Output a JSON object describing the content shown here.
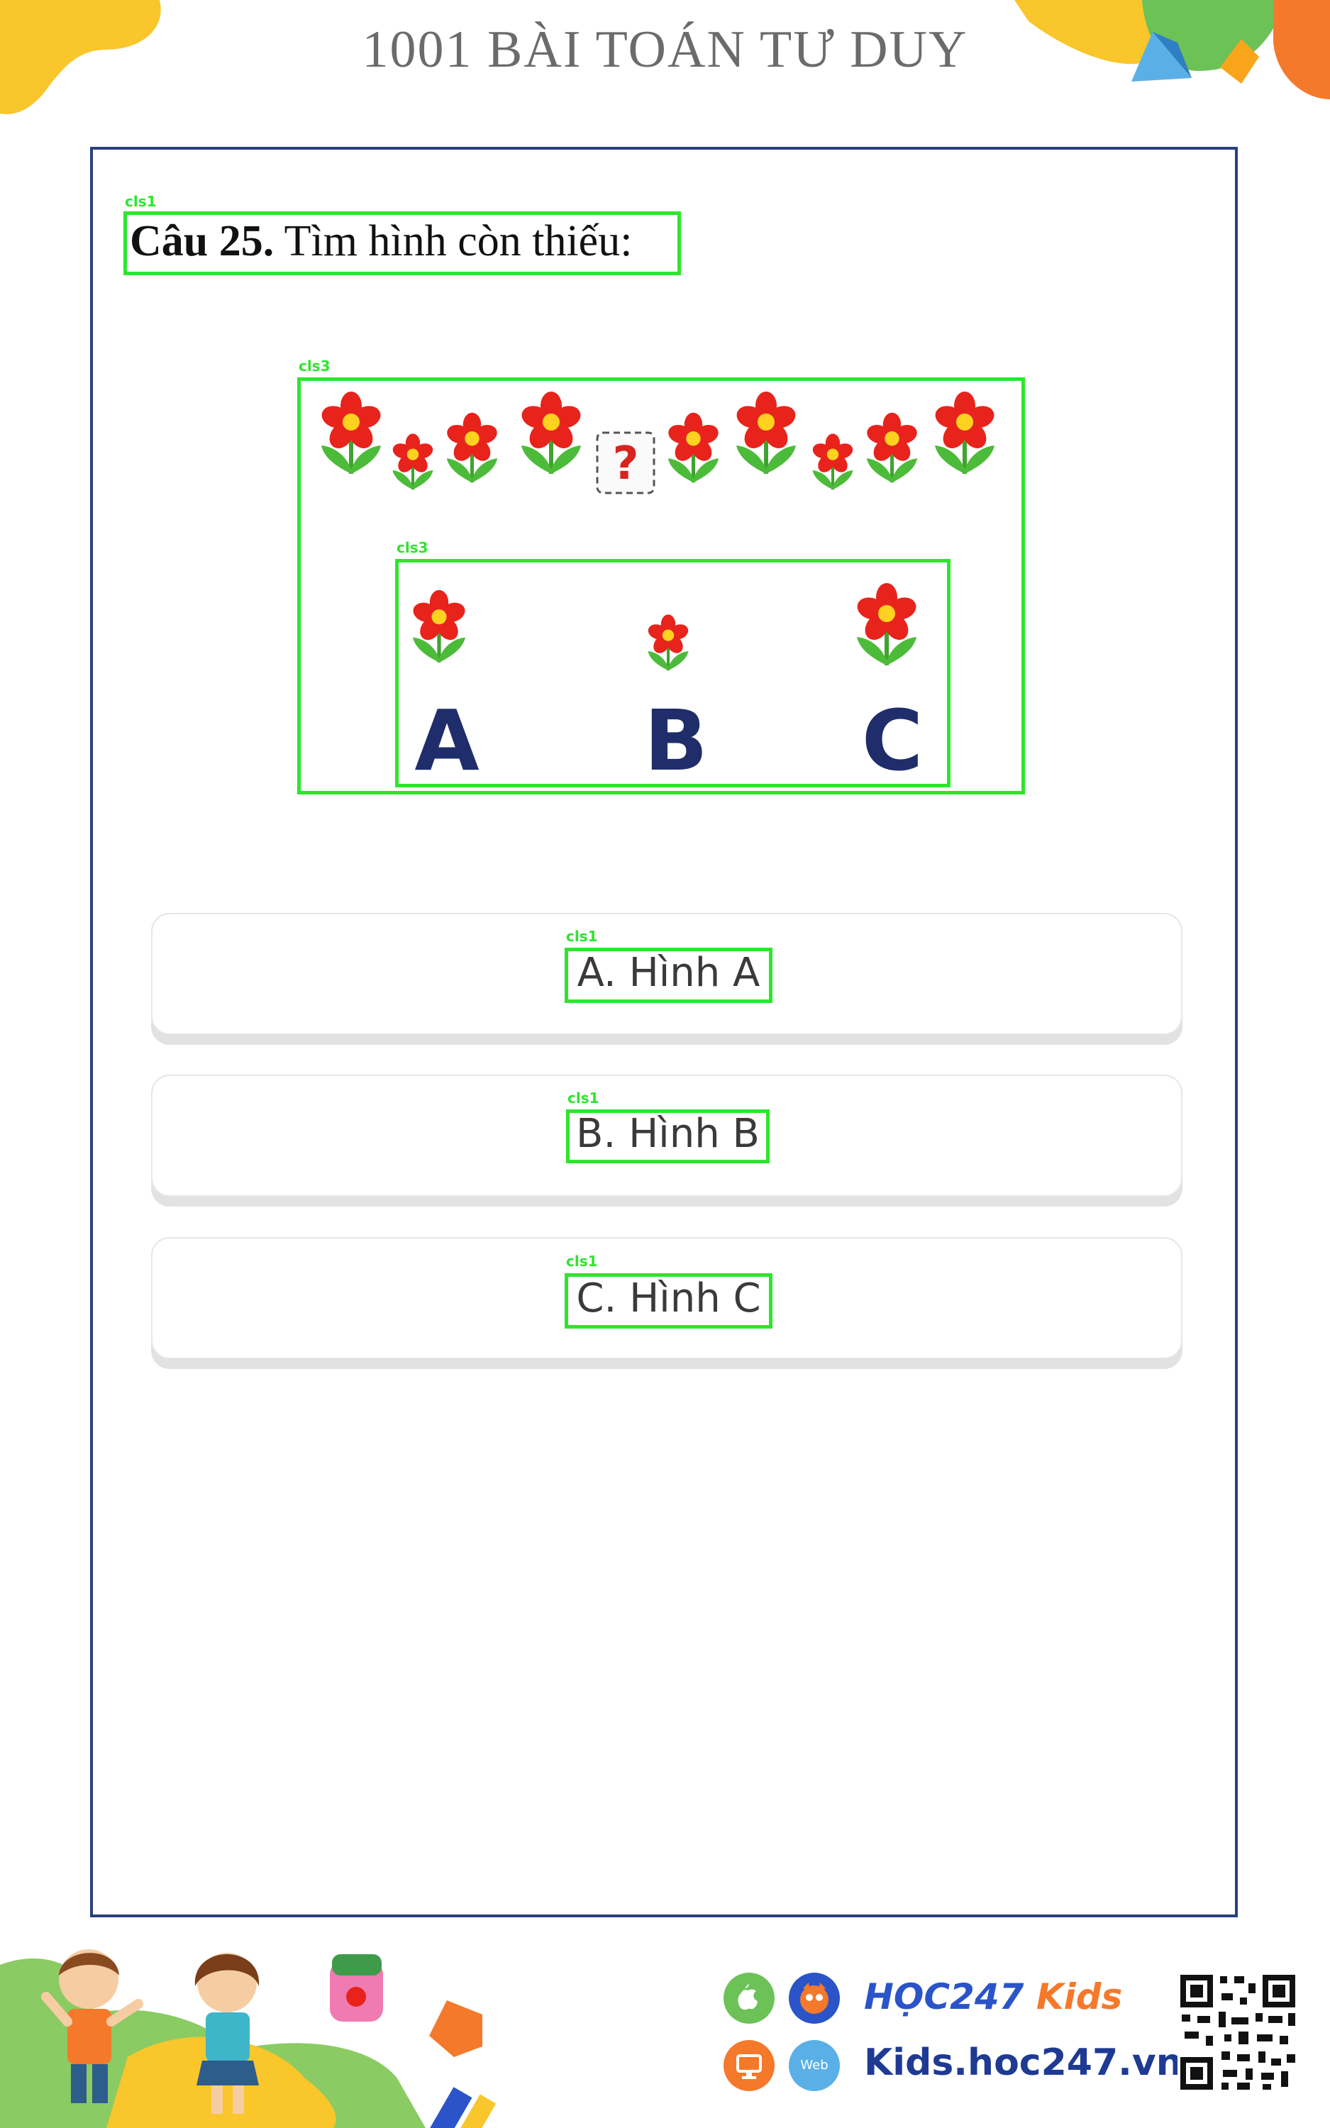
{
  "header": {
    "title": "1001 BÀI TOÁN TƯ DUY"
  },
  "question": {
    "tag": "cls1",
    "number": "Câu 25.",
    "text": "Tìm hình còn thiếu:"
  },
  "figure": {
    "tag": "cls3",
    "missing_mark": "?",
    "options_tag": "cls3",
    "options": [
      {
        "letter": "A"
      },
      {
        "letter": "B"
      },
      {
        "letter": "C"
      }
    ]
  },
  "answers": [
    {
      "tag": "cls1",
      "label": "A. Hình A"
    },
    {
      "tag": "cls1",
      "label": "B. Hình B"
    },
    {
      "tag": "cls1",
      "label": "C. Hình C"
    }
  ],
  "footer": {
    "brand_main": "HỌC247",
    "brand_sub": "Kids",
    "site": "Kids.hoc247.vn",
    "web_badge": "Web"
  },
  "colors": {
    "frame": "#2b3f7c",
    "detection": "#2ee52e",
    "petal": "#e8231c",
    "center": "#ffd21f",
    "leaf": "#4dbb3a",
    "letters": "#1f2d6b"
  }
}
